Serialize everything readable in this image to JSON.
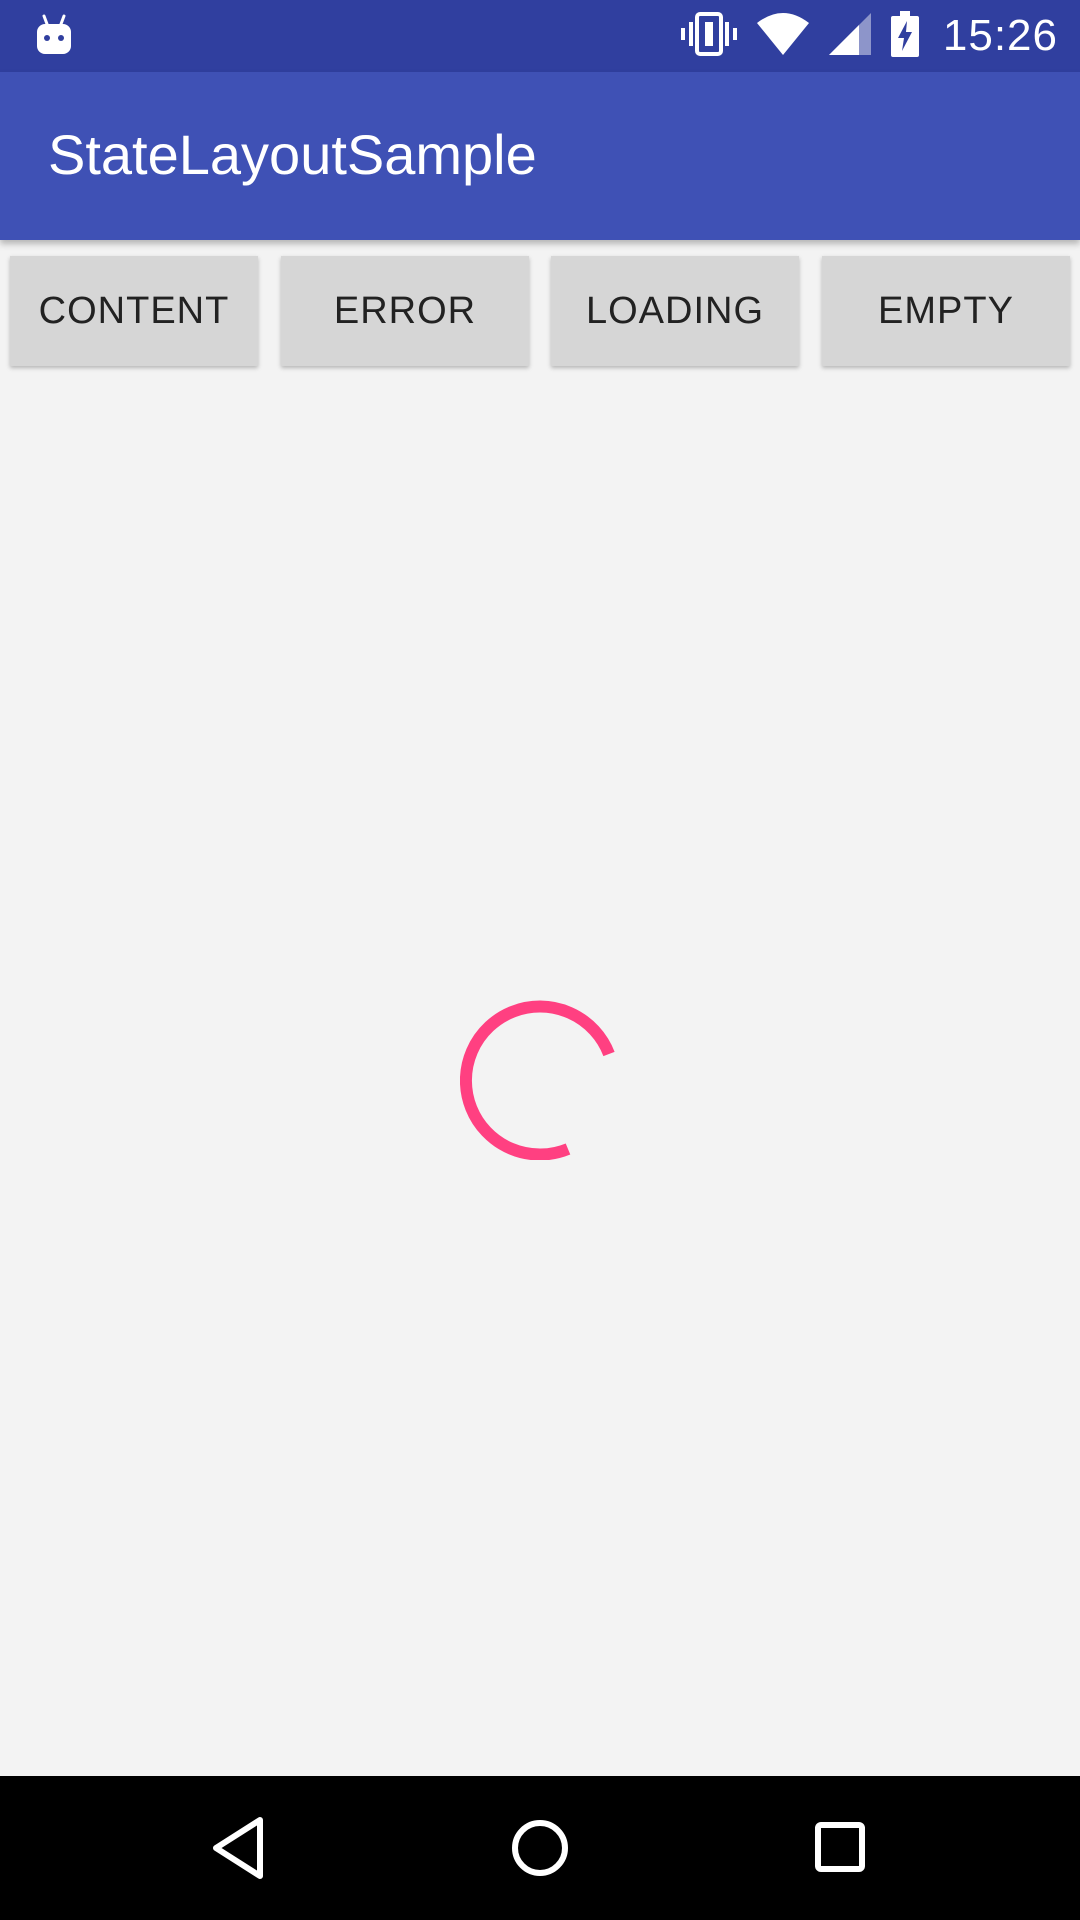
{
  "status_bar": {
    "time": "15:26",
    "icons": [
      "android-debug-icon",
      "vibrate-icon",
      "wifi-icon",
      "cell-signal-icon",
      "battery-charging-icon"
    ]
  },
  "toolbar": {
    "title": "StateLayoutSample"
  },
  "buttons": {
    "content": "CONTENT",
    "error": "ERROR",
    "loading": "LOADING",
    "empty": "EMPTY"
  },
  "loading": {
    "indicator": "progress-spinner",
    "color": "#ff4081"
  },
  "nav_bar": {
    "icons": [
      "back-icon",
      "home-icon",
      "recents-icon"
    ]
  },
  "colors": {
    "status_bar": "#303f9f",
    "primary": "#3f51b5",
    "accent": "#ff4081",
    "background": "#f3f3f3",
    "button": "#d6d6d6"
  }
}
